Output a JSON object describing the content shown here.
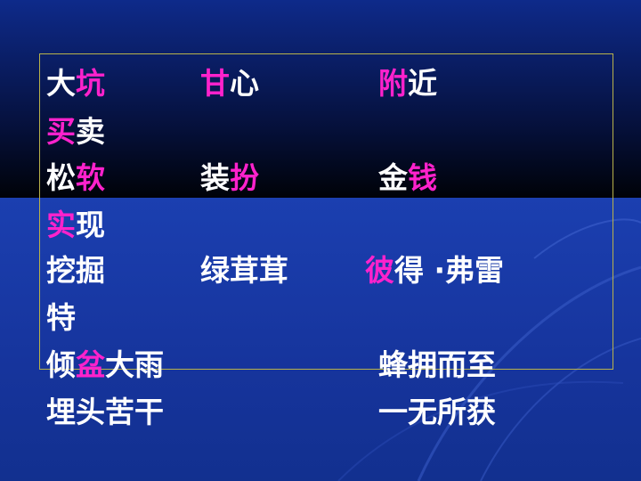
{
  "colors": {
    "text": "#ffffff",
    "highlight": "#ff22cc",
    "frame_border": "#b9b24a",
    "background_top": "#000208",
    "background_bottom": "#16349c"
  },
  "rows": [
    {
      "c1a": "大",
      "c1b": "坑",
      "c2a": "甘",
      "c2b": "心",
      "c3a": "附",
      "c3b": "近"
    },
    {
      "c1a": "买",
      "c1b": "卖"
    },
    {
      "c1a": "松",
      "c1b": "软",
      "c2a": "装",
      "c2b": "扮",
      "c3a": "金",
      "c3b": "钱"
    },
    {
      "c1a": "实",
      "c1b": "现"
    },
    {
      "c1": "挖掘",
      "c2": "绿茸茸",
      "c3a": "彼",
      "c3b": "得 ·弗雷"
    },
    {
      "c1": "特"
    },
    {
      "c1a": "倾",
      "c1b": "盆",
      "c1c": "大雨",
      "c3": "蜂拥而至"
    },
    {
      "c1": "埋头苦干",
      "c3": "一无所获"
    }
  ]
}
